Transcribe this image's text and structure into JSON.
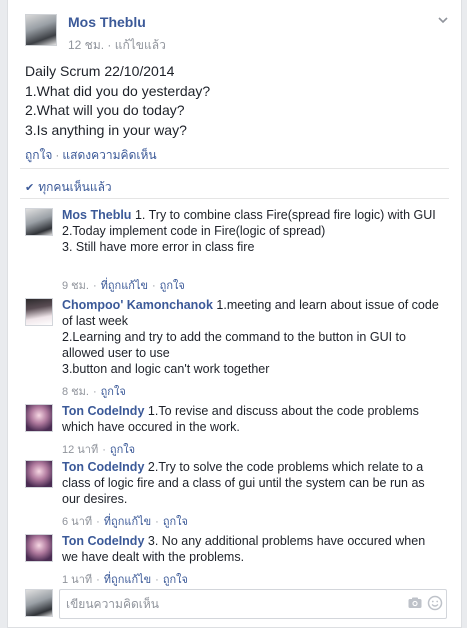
{
  "post": {
    "author": "Mos Theblu",
    "time": "12 ชม.",
    "edited": "แก้ไขแล้ว",
    "separator": "·",
    "body_lines": [
      "Daily Scrum 22/10/2014",
      "1.What did you do yesterday?",
      "2.What will you do today?",
      "3.Is anything in your way?"
    ],
    "like_label": "ถูกใจ",
    "comment_label": "แสดงความคิดเห็น",
    "seen_label": "ทุกคนเห็นแล้ว"
  },
  "comments": [
    {
      "author": "Mos Theblu",
      "text_lines": [
        "1. Try to combine class Fire(spread fire logic) with GUI",
        "2.Today implement code in Fire(logic of spread)",
        "3. Still have more error in class fire"
      ],
      "time": "9 ชม.",
      "edited": "ที่ถูกแก้ไข",
      "like_label": "ถูกใจ"
    },
    {
      "author": "Chompoo' Kamonchanok",
      "text_lines": [
        "1.meeting and learn about issue of code of last week",
        "2.Learning and try to add the command to the button in GUI to allowed user to use",
        "3.button and logic can't work together"
      ],
      "time": "8 ชม.",
      "edited": "",
      "like_label": "ถูกใจ"
    },
    {
      "author": "Ton CodeIndy",
      "text_lines": [
        "1.To revise and discuss about the code problems which have occured in the work."
      ],
      "time": "12 นาที",
      "edited": "",
      "like_label": "ถูกใจ"
    },
    {
      "author": "Ton CodeIndy",
      "text_lines": [
        "2.Try to solve the code problems which relate to a class of logic fire and a class of gui until the system can be run as our desires."
      ],
      "time": "6 นาที",
      "edited": "ที่ถูกแก้ไข",
      "like_label": "ถูกใจ"
    },
    {
      "author": "Ton CodeIndy",
      "text_lines": [
        "3. No any additional problems have occured when we have dealt with the problems."
      ],
      "time": "1 นาที",
      "edited": "ที่ถูกแก้ไข",
      "like_label": "ถูกใจ"
    }
  ],
  "composer": {
    "placeholder": "เขียนความคิดเห็น",
    "icons": [
      "camera-icon",
      "smile-icon",
      "chevron-down-icon",
      "check-icon"
    ]
  },
  "colors": {
    "link": "#3b5998",
    "meta": "#90949c",
    "text": "#1d2129",
    "background": "#e9ebee"
  }
}
